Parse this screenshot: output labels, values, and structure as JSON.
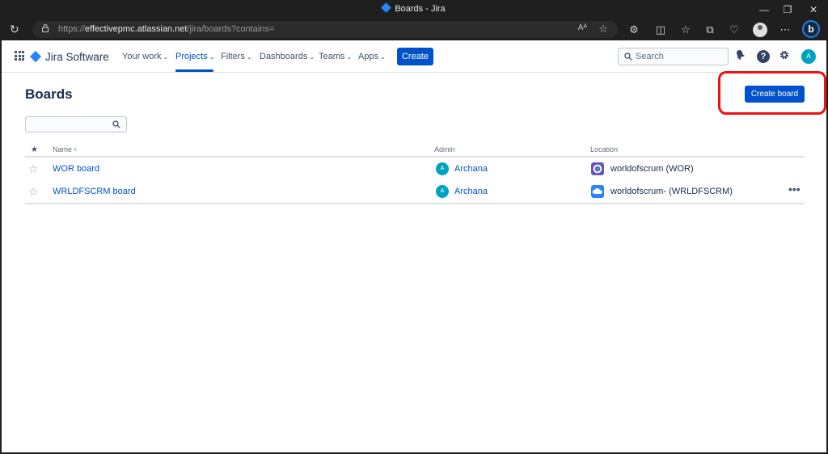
{
  "browser": {
    "window_title": "Boards - Jira",
    "url_prefix": "https://",
    "url_host": "effectivepmc.atlassian.net",
    "url_path": "/jira/boards?contains=",
    "read_aloud_label": "Aᴬ"
  },
  "nav": {
    "brand": "Jira Software",
    "items": [
      {
        "label": "Your work",
        "active": false
      },
      {
        "label": "Projects",
        "active": true
      },
      {
        "label": "Filters",
        "active": false
      },
      {
        "label": "Dashboards",
        "active": false
      },
      {
        "label": "Teams",
        "active": false
      },
      {
        "label": "Apps",
        "active": false
      }
    ],
    "create_label": "Create",
    "search_placeholder": "Search",
    "user_initial": "A"
  },
  "page": {
    "title": "Boards",
    "create_board_label": "Create board",
    "filter_placeholder": ""
  },
  "table": {
    "headers": {
      "star": "★",
      "name": "Name",
      "sort_indicator": "˄",
      "admin": "Admin",
      "location": "Location"
    },
    "rows": [
      {
        "name": "WOR board",
        "admin_initial": "A",
        "admin": "Archana",
        "location": "worldofscrum (WOR)",
        "project_icon_color": "#6554c0"
      },
      {
        "name": "WRLDFSCRM board",
        "admin_initial": "A",
        "admin": "Archana",
        "location": "worldofscrum- (WRLDFSCRM)",
        "project_icon_color": "#2684ff"
      }
    ],
    "more_label": "•••"
  },
  "colors": {
    "primary": "#0052cc",
    "highlight": "#ee1212",
    "avatar": "#00a3bf"
  }
}
